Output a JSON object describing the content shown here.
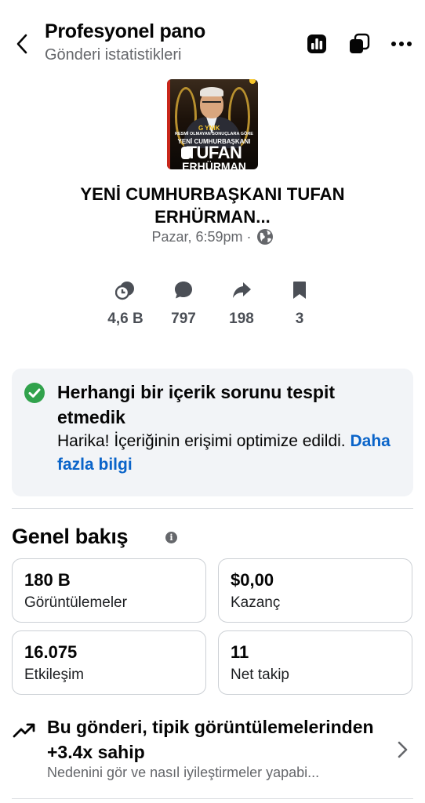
{
  "header": {
    "title": "Profesyonel pano",
    "subtitle": "Gönderi istatistikleri"
  },
  "post": {
    "thumbnail": {
      "tag": "G YNIK",
      "line1": "RESMİ OLMAYAN SONUÇLARA GÖRE",
      "line2": "YENİ CUMHURBAŞKANI",
      "line3": "TUFAN",
      "line4": "ERHÜRMAN"
    },
    "headline": "YENİ CUMHURBAŞKANI TUFAN ERHÜRMAN...",
    "date": "Pazar, 6:59pm ·"
  },
  "stats": [
    {
      "icon": "reactions-icon",
      "value": "4,6 B"
    },
    {
      "icon": "comment-icon",
      "value": "797"
    },
    {
      "icon": "share-icon",
      "value": "198"
    },
    {
      "icon": "bookmark-icon",
      "value": "3"
    }
  ],
  "notice": {
    "title": "Herhangi bir içerik sorunu tespit etmedik",
    "text": "Harika! İçeriğinin erişimi optimize edildi.",
    "link": "Daha fazla bilgi",
    "status_color": "#31a24c"
  },
  "overview": {
    "title": "Genel bakış",
    "cards": [
      {
        "value": "180 B",
        "label": "Görüntülemeler"
      },
      {
        "value": "$0,00",
        "label": "Kazanç"
      },
      {
        "value": "16.075",
        "label": "Etkileşim"
      },
      {
        "value": "11",
        "label": "Net takip"
      }
    ]
  },
  "insight": {
    "title": "Bu gönderi, tipik görüntülemelerinden +3.4x sahip",
    "subtitle": "Nedenini gör ve nasıl iyileştirmeler yapabi..."
  },
  "colors": {
    "link": "#0a64c9",
    "secondary_text": "#65676b",
    "panel_bg": "#f2f4f7"
  }
}
